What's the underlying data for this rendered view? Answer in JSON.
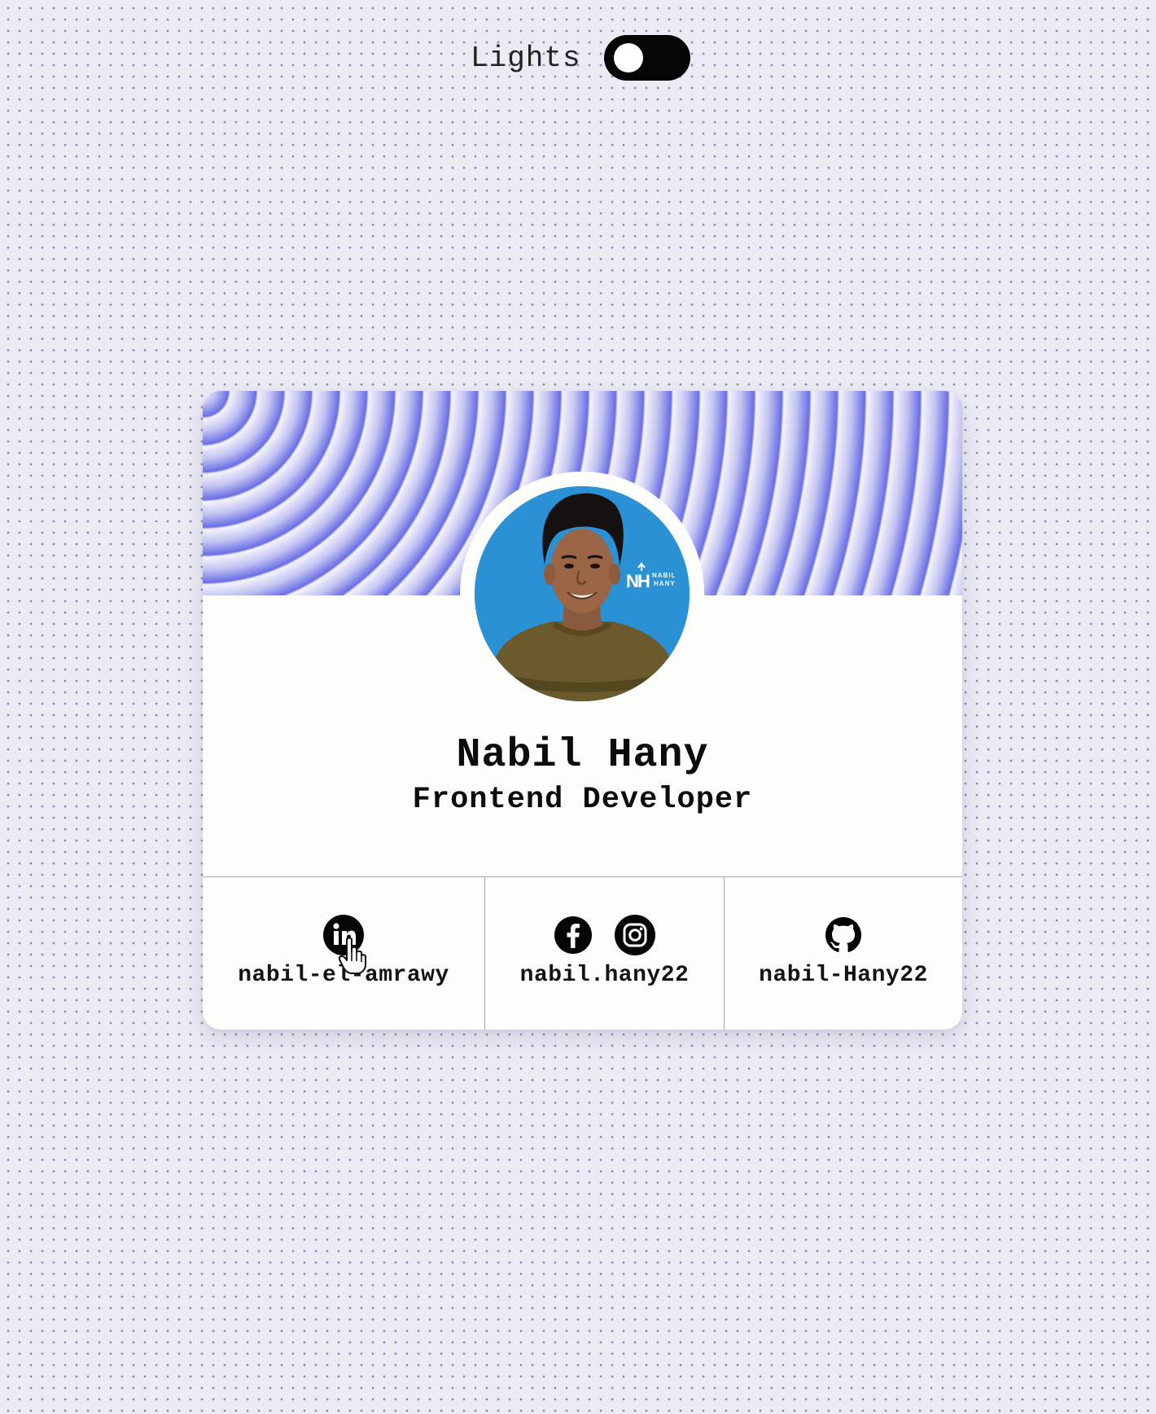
{
  "lights": {
    "label": "Lights",
    "toggle_on": false
  },
  "profile": {
    "name": "Nabil Hany",
    "title": "Frontend Developer",
    "avatar_badge_line1": "NABIL",
    "avatar_badge_line2": "HANY"
  },
  "socials": [
    {
      "icons": [
        "linkedin-icon"
      ],
      "handle": "nabil-el-amrawy"
    },
    {
      "icons": [
        "facebook-icon",
        "instagram-icon"
      ],
      "handle": "nabil.hany22"
    },
    {
      "icons": [
        "github-icon"
      ],
      "handle": "nabil-Hany22"
    }
  ],
  "colors": {
    "page_background": "#ebebf4",
    "banner_accent": "#6a6ee6",
    "card_background": "#fdfdfc",
    "avatar_background": "#2a91d5"
  }
}
